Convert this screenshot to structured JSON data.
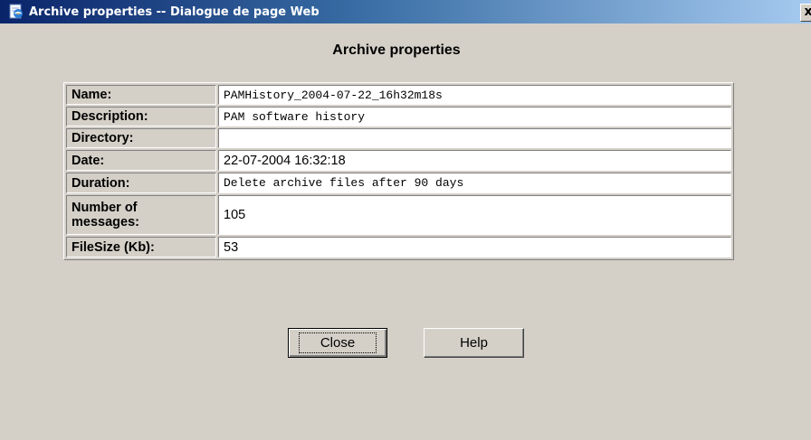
{
  "window": {
    "title": "Archive properties -- Dialogue de page Web",
    "close_glyph": "x",
    "icon": "ie-page-icon"
  },
  "dialog": {
    "heading": "Archive properties"
  },
  "properties": [
    {
      "label": "Name:",
      "value": "PAMHistory_2004-07-22_16h32m18s"
    },
    {
      "label": "Description:",
      "value": "PAM software history"
    },
    {
      "label": "Directory:",
      "value": ""
    },
    {
      "label": "Date:",
      "value": "22-07-2004 16:32:18"
    },
    {
      "label": "Duration:",
      "value": "Delete archive files after 90 days"
    },
    {
      "label_line1": "Number of",
      "label_line2": "messages:",
      "value": "105"
    },
    {
      "label": "FileSize (Kb):",
      "value": "53"
    }
  ],
  "buttons": {
    "close_label": "Close",
    "help_label": "Help"
  },
  "colors": {
    "title_bar_start": "#0a246a",
    "title_bar_end": "#a6caf0",
    "dialog_bg": "#d4d0c8"
  }
}
